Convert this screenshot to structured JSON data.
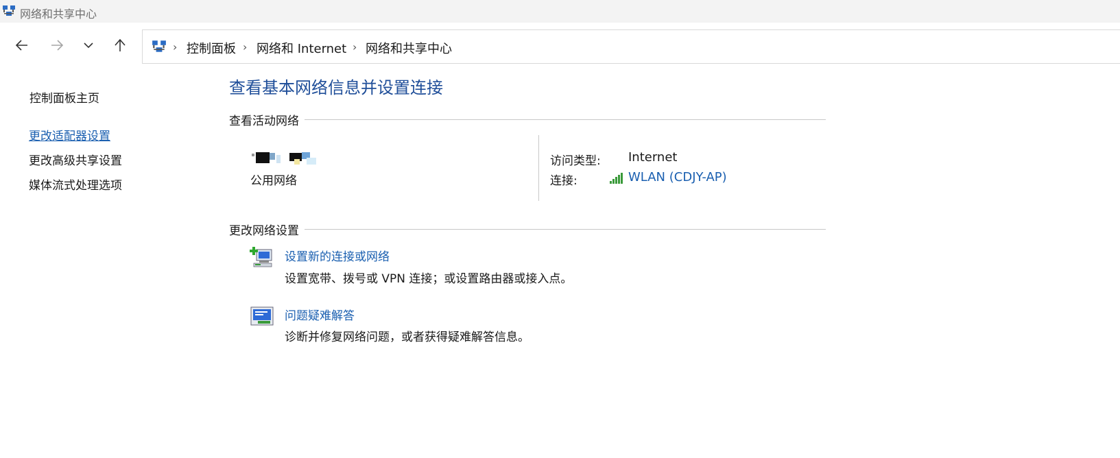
{
  "window": {
    "title": "网络和共享中心",
    "icon": "network-center-icon"
  },
  "navigation": {
    "back_icon": "arrow-left-icon",
    "forward_icon": "arrow-right-icon",
    "recent_icon": "chevron-down-icon",
    "up_icon": "arrow-up-icon"
  },
  "breadcrumb": {
    "items": [
      "控制面板",
      "网络和 Internet",
      "网络和共享中心"
    ],
    "separator": "›"
  },
  "sidebar": {
    "home": "控制面板主页",
    "links": [
      "更改适配器设置",
      "更改高级共享设置",
      "媒体流式处理选项"
    ]
  },
  "main": {
    "title": "查看基本网络信息并设置连接",
    "active_network_header": "查看活动网络",
    "network": {
      "type": "公用网络",
      "access_type_label": "访问类型:",
      "access_type_value": "Internet",
      "connection_label": "连接:",
      "connection_value": "WLAN (CDJY-AP)"
    },
    "change_settings_header": "更改网络设置",
    "tasks": [
      {
        "icon": "new-connection-icon",
        "link": "设置新的连接或网络",
        "description": "设置宽带、拨号或 VPN 连接；或设置路由器或接入点。"
      },
      {
        "icon": "troubleshoot-icon",
        "link": "问题疑难解答",
        "description": "诊断并修复网络问题，或者获得疑难解答信息。"
      }
    ]
  },
  "colors": {
    "link": "#1a5fb0",
    "title": "#1f4e99",
    "signal": "#3a9a3a"
  }
}
